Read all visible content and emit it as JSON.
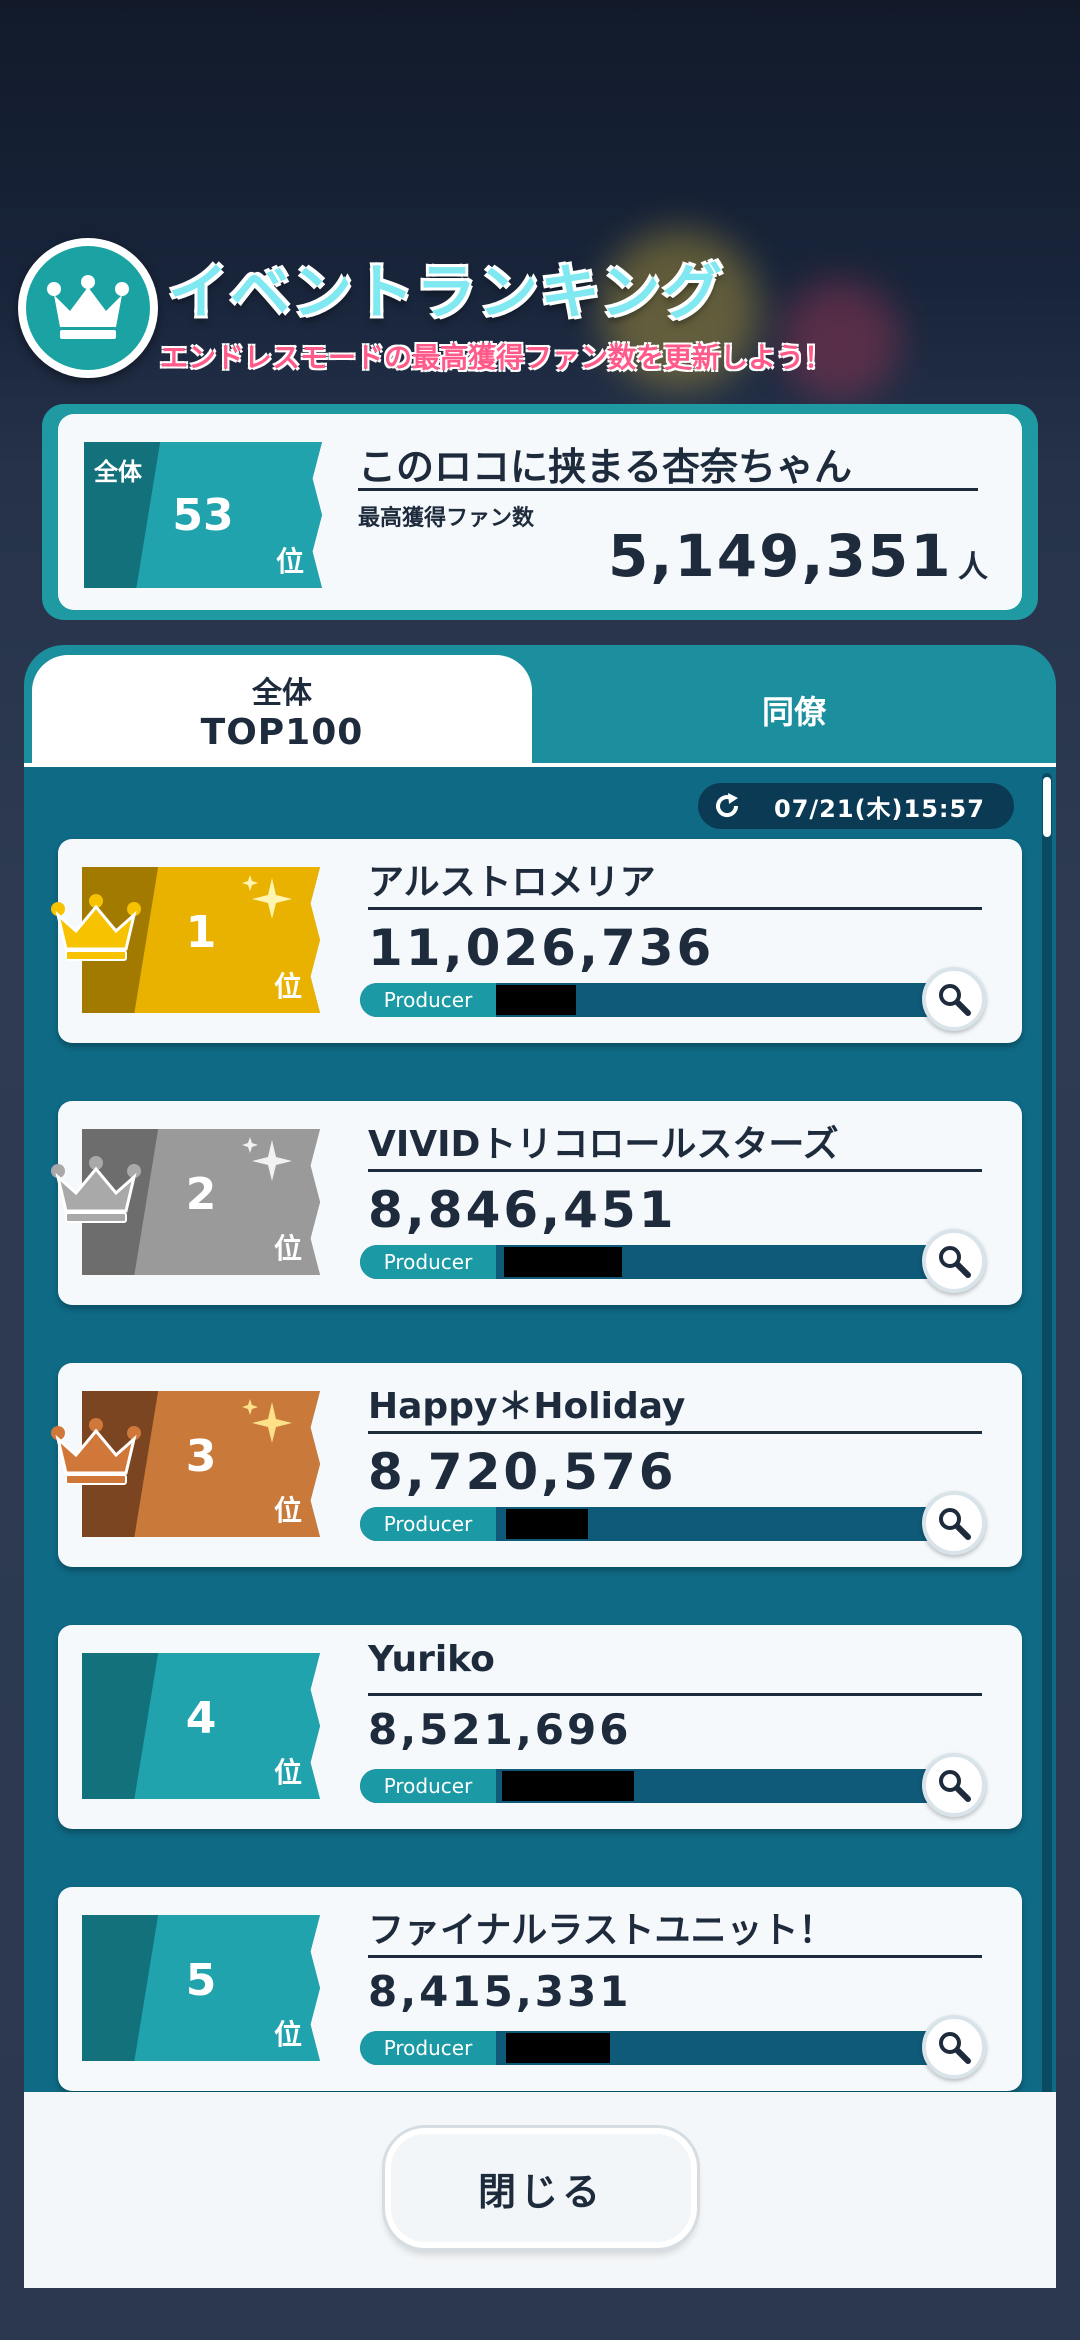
{
  "header": {
    "title": "イベントランキング",
    "subtitle": "エンドレスモードの最高獲得ファン数を更新しよう！"
  },
  "my_rank": {
    "scope_label": "全体",
    "rank": "53",
    "rank_suffix": "位",
    "name": "このロコに挟まる杏奈ちゃん",
    "fans_label": "最高獲得ファン数",
    "fans": "5,149,351",
    "fans_unit": "人"
  },
  "tabs": {
    "overall_line1": "全体",
    "overall_line2": "TOP100",
    "colleague": "同僚"
  },
  "updated_at": "07/21(木)15:57",
  "entries": [
    {
      "rank": "1",
      "suffix": "位",
      "name": "アルストロメリア",
      "fans": "11,026,736",
      "producer_label": "Producer",
      "medal": "gold"
    },
    {
      "rank": "2",
      "suffix": "位",
      "name": "VIVIDトリコロールスターズ",
      "fans": "8,846,451",
      "producer_label": "Producer",
      "medal": "silver"
    },
    {
      "rank": "3",
      "suffix": "位",
      "name": "Happy＊Holiday",
      "fans": "8,720,576",
      "producer_label": "Producer",
      "medal": "bronze"
    },
    {
      "rank": "4",
      "suffix": "位",
      "name": "Yuriko",
      "fans": "8,521,696",
      "producer_label": "Producer",
      "medal": "none"
    },
    {
      "rank": "5",
      "suffix": "位",
      "name": "ファイナルラストユニット！",
      "fans": "8,415,331",
      "producer_label": "Producer",
      "medal": "none"
    }
  ],
  "close_button": "閉じる",
  "colors": {
    "teal": "#1b8f9e",
    "gold": "#e9b200",
    "silver": "#9a9a9a",
    "bronze": "#c97a3a",
    "navy": "#1e2b3c"
  }
}
